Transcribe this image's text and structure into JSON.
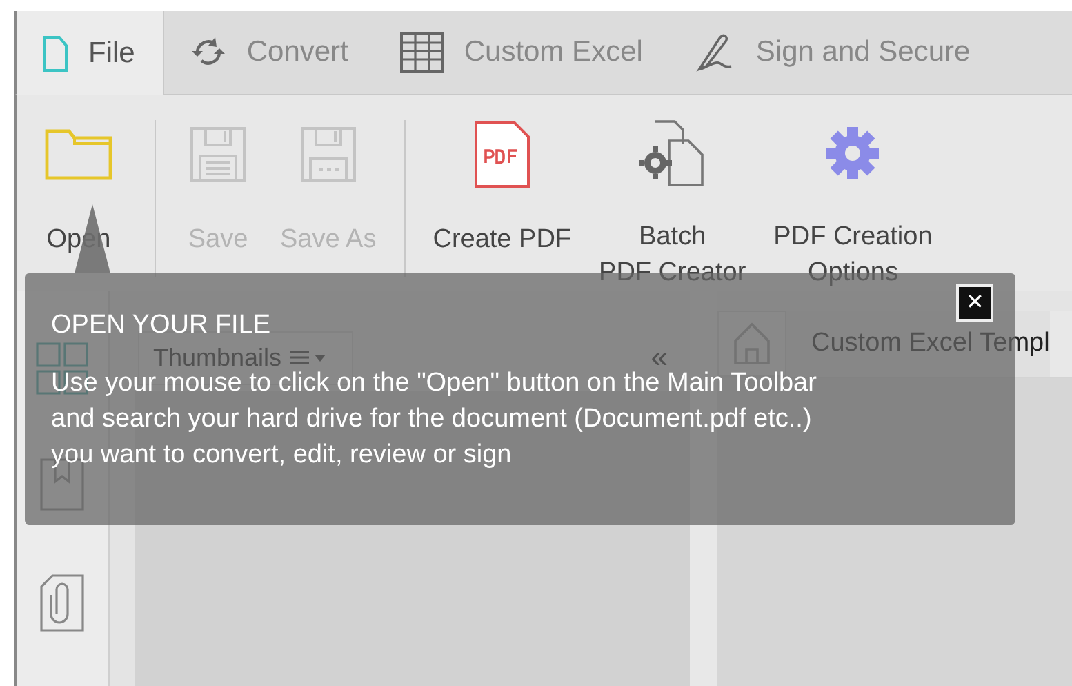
{
  "tabs": [
    {
      "label": "File",
      "selected": true
    },
    {
      "label": "Convert",
      "selected": false
    },
    {
      "label": "Custom Excel",
      "selected": false
    },
    {
      "label": "Sign and Secure",
      "selected": false
    }
  ],
  "ribbon": {
    "groups": [
      [
        {
          "label": "Open",
          "disabled": false
        }
      ],
      [
        {
          "label": "Save",
          "disabled": true
        },
        {
          "label": "Save As",
          "disabled": true
        }
      ],
      [
        {
          "label": "Create PDF",
          "disabled": false
        },
        {
          "label": "Batch\nPDF Creator",
          "disabled": false
        },
        {
          "label": "PDF Creation\nOptions",
          "disabled": false
        }
      ]
    ]
  },
  "thumbnails_panel": {
    "view_select": "Thumbnails",
    "collapse": "«"
  },
  "document_tab": {
    "label": "Custom Excel Templ"
  },
  "tooltip": {
    "title": "OPEN YOUR FILE",
    "text": "Use your mouse to click on the \"Open\" button on the Main Toolbar\nand search your hard drive for the document (Document.pdf etc..)\nyou want to convert, edit, review or sign",
    "close": "✕"
  }
}
